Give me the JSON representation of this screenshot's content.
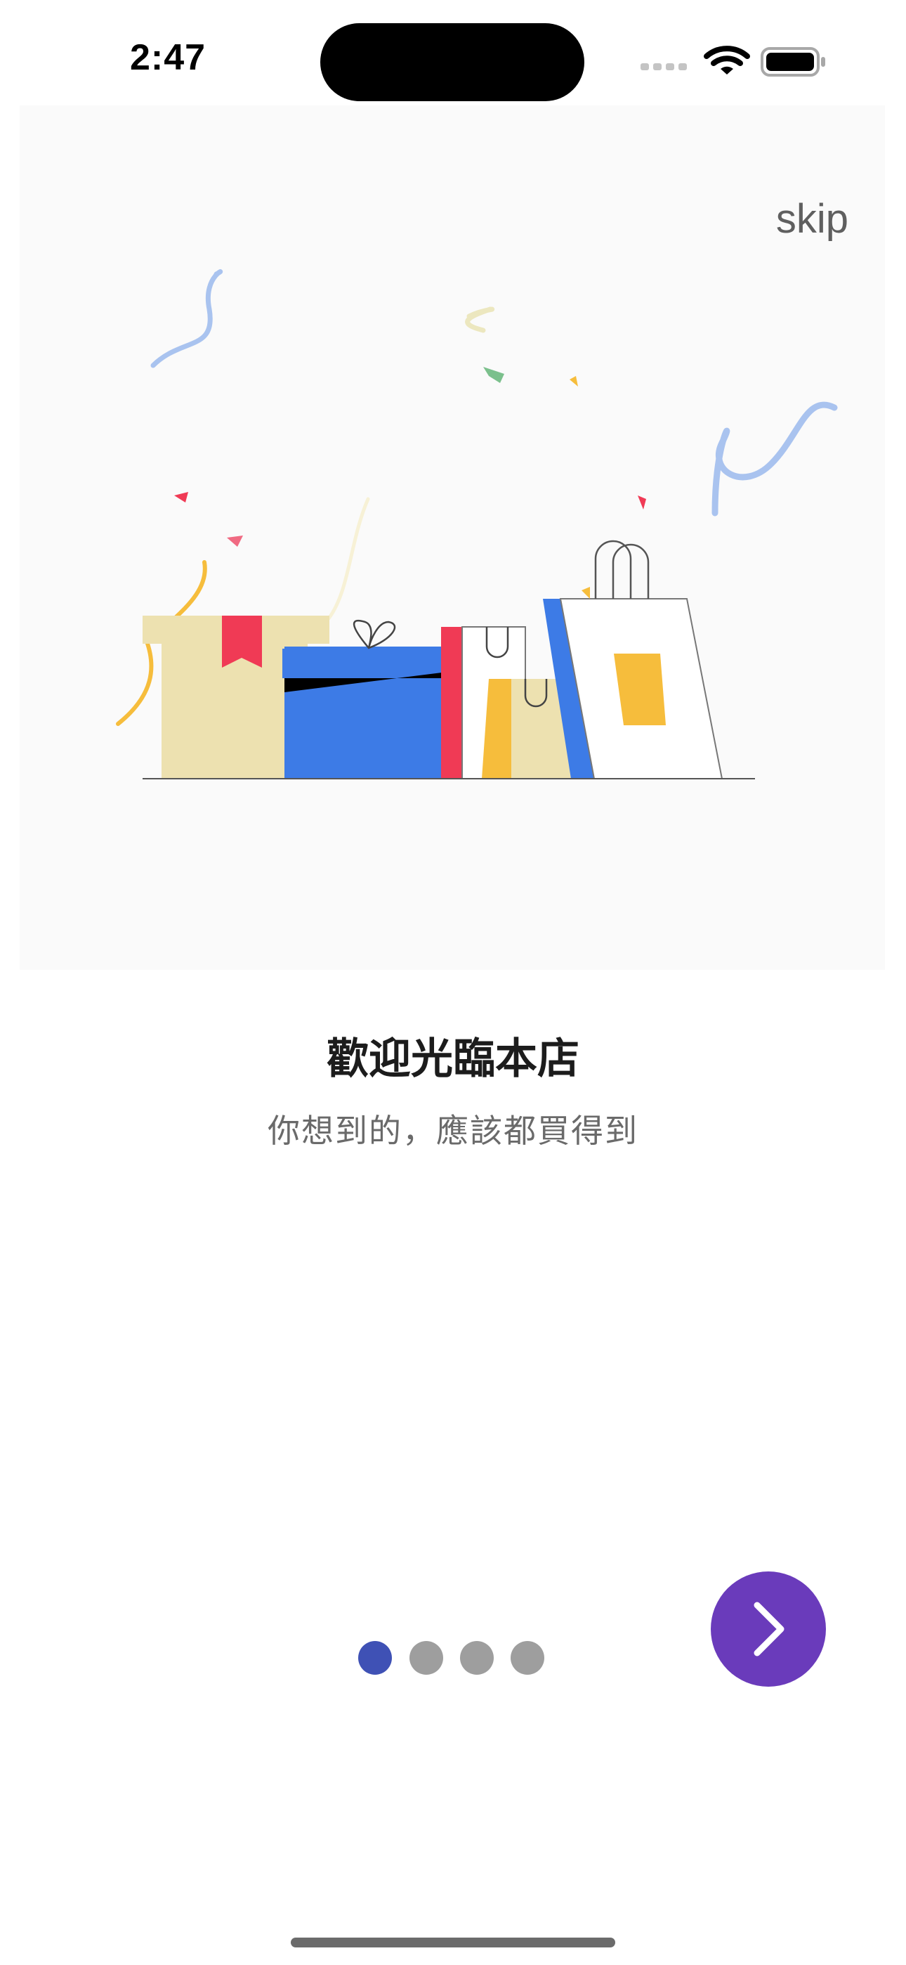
{
  "status_bar": {
    "time": "2:47",
    "icons": [
      "cellular-signal-icon",
      "wifi-icon",
      "battery-icon"
    ]
  },
  "onboarding": {
    "skip_label": "skip",
    "title": "歡迎光臨本店",
    "subtitle": "你想到的，應該都買得到",
    "illustration": "gift-boxes-and-shopping-bags-with-confetti",
    "current_page": 1,
    "page_count": 4,
    "next_icon": "chevron-right-icon"
  },
  "colors": {
    "accent": "#6a3bbb",
    "dot_active": "#3f51b5",
    "dot_inactive": "#9e9e9e",
    "illustration_blue": "#3d7be6",
    "illustration_red": "#f03a55",
    "illustration_yellow": "#f6bd3c",
    "illustration_beige": "#ede1b0"
  }
}
